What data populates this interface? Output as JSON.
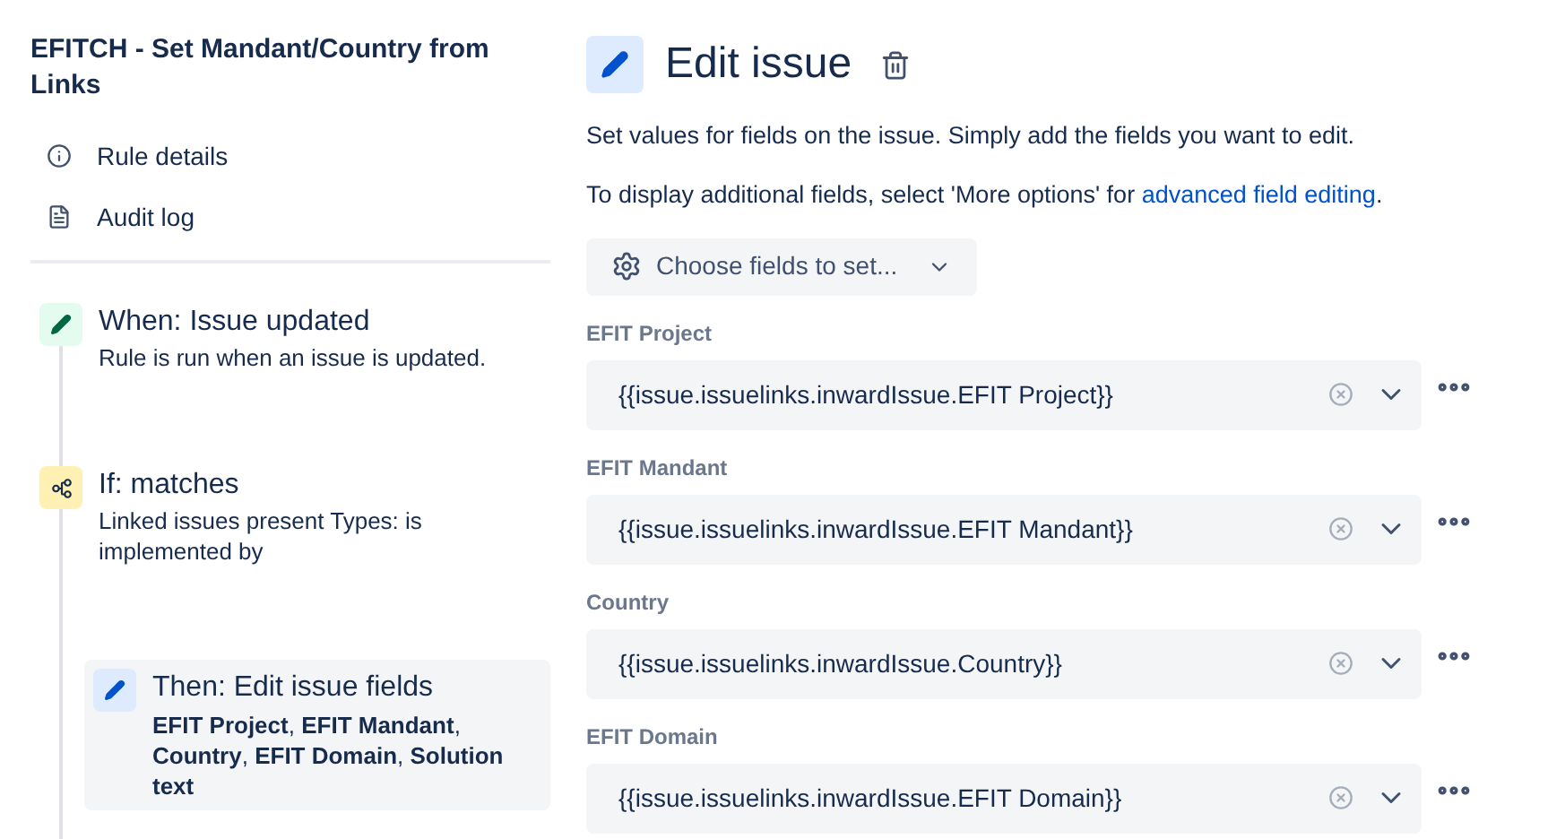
{
  "sidebar": {
    "title": "EFITCH - Set Mandant/Country from Links",
    "nav": [
      {
        "kind": "info",
        "label": "Rule details"
      },
      {
        "kind": "log",
        "label": "Audit log"
      }
    ],
    "steps": [
      {
        "kind": "trigger",
        "title": "When: Issue updated",
        "description": "Rule is run when an issue is updated.",
        "selected": false
      },
      {
        "kind": "condition",
        "title": "If: matches",
        "description": "Linked issues present Types: is implemented by",
        "selected": false
      },
      {
        "kind": "action",
        "title": "Then: Edit issue fields",
        "description": "**EFIT Project**, **EFIT Mandant**, **Country**, **EFIT Domain**, **Solution text**",
        "selected": true
      }
    ]
  },
  "editor": {
    "title": "Edit issue",
    "intro": "Set values for fields on the issue. Simply add the fields you want to edit.",
    "hint": "To display additional fields, select 'More options' for",
    "hint_link": "advanced field editing",
    "hint_end": ".",
    "choose_button": "Choose fields to set...",
    "fields": [
      {
        "label": "EFIT Project",
        "value": "{{issue.issuelinks.inwardIssue.EFIT Project}}"
      },
      {
        "label": "EFIT Mandant",
        "value": "{{issue.issuelinks.inwardIssue.EFIT Mandant}}"
      },
      {
        "label": "Country",
        "value": "{{issue.issuelinks.inwardIssue.Country}}"
      },
      {
        "label": "EFIT Domain",
        "value": "{{issue.issuelinks.inwardIssue.EFIT Domain}}"
      }
    ]
  }
}
